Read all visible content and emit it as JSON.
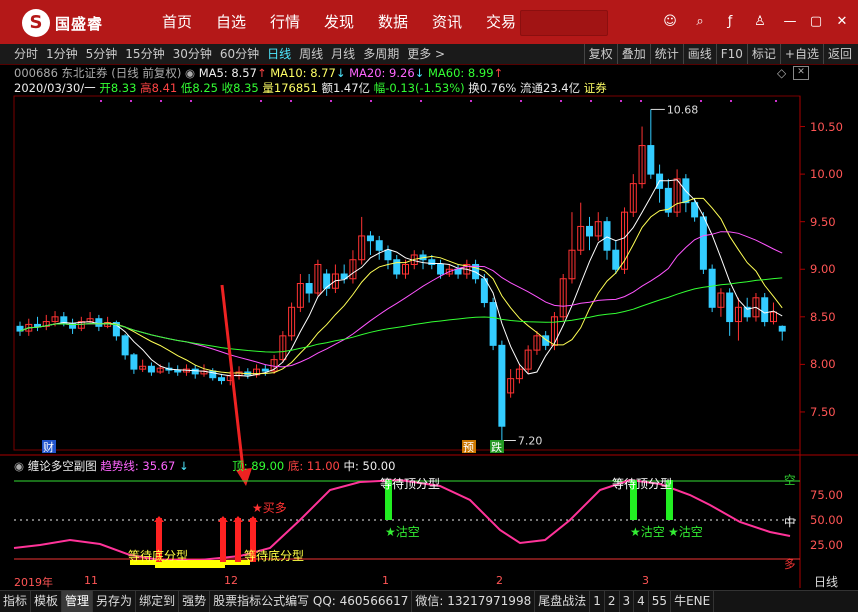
{
  "app": {
    "name": "国盛睿",
    "logo_mark": "S"
  },
  "top_nav": [
    "首页",
    "自选",
    "行情",
    "发现",
    "数据",
    "资讯",
    "交易"
  ],
  "window_controls": [
    "chat-icon",
    "search-icon",
    "fx-icon",
    "shirt-icon",
    "minimize-icon",
    "maximize-icon",
    "close-icon"
  ],
  "period_tabs": [
    "分时",
    "1分钟",
    "5分钟",
    "15分钟",
    "30分钟",
    "60分钟",
    "日线",
    "周线",
    "月线",
    "多周期",
    "更多 >"
  ],
  "active_period": "日线",
  "right_tools": [
    "复权",
    "叠加",
    "统计",
    "画线",
    "F10",
    "标记",
    "+自选",
    "返回"
  ],
  "stock": {
    "title": "000686 东北证券 (日线 前复权)",
    "ma5": "MA5: 8.57",
    "ma10": "MA10: 8.77",
    "ma20": "MA20: 9.26",
    "ma60": "MA60: 8.99",
    "line2_date": "2020/03/30/一",
    "open": "开8.33",
    "high": "高8.41",
    "low": "低8.25",
    "close": "收8.35",
    "volume": "量176851",
    "amount": "额1.47亿",
    "change": "幅-0.13(-1.53%)",
    "turnover": "换0.76%",
    "float": "流通23.4亿",
    "sector": "证券"
  },
  "annotations": {
    "high": "10.68",
    "low": "7.20",
    "cai": "财",
    "yu": "预",
    "die": "跌"
  },
  "chart_data": [
    {
      "type": "candlestick",
      "title": "000686 东北证券 (日线 前复权)",
      "yticks": [
        7.5,
        8.0,
        8.5,
        9.0,
        9.5,
        10.0,
        10.5
      ],
      "ylim": [
        7.1,
        10.8
      ],
      "series": [
        {
          "name": "MA5"
        },
        {
          "name": "MA10"
        },
        {
          "name": "MA20"
        },
        {
          "name": "MA60"
        }
      ],
      "candles": [
        [
          8.4,
          8.35,
          8.45,
          8.3
        ],
        [
          8.35,
          8.42,
          8.48,
          8.3
        ],
        [
          8.42,
          8.4,
          8.5,
          8.35
        ],
        [
          8.4,
          8.45,
          8.52,
          8.36
        ],
        [
          8.45,
          8.5,
          8.56,
          8.4
        ],
        [
          8.5,
          8.43,
          8.55,
          8.4
        ],
        [
          8.43,
          8.38,
          8.48,
          8.32
        ],
        [
          8.38,
          8.45,
          8.5,
          8.35
        ],
        [
          8.45,
          8.48,
          8.55,
          8.42
        ],
        [
          8.48,
          8.4,
          8.52,
          8.35
        ],
        [
          8.4,
          8.44,
          8.5,
          8.38
        ],
        [
          8.44,
          8.3,
          8.46,
          8.25
        ],
        [
          8.3,
          8.1,
          8.32,
          8.05
        ],
        [
          8.1,
          7.95,
          8.12,
          7.9
        ],
        [
          7.95,
          7.98,
          8.05,
          7.92
        ],
        [
          7.98,
          7.92,
          8.02,
          7.88
        ],
        [
          7.92,
          7.96,
          8.0,
          7.9
        ],
        [
          7.96,
          7.94,
          8.02,
          7.9
        ],
        [
          7.94,
          7.92,
          7.99,
          7.88
        ],
        [
          7.92,
          7.95,
          8.0,
          7.88
        ],
        [
          7.95,
          7.9,
          7.99,
          7.85
        ],
        [
          7.9,
          7.93,
          8.0,
          7.87
        ],
        [
          7.93,
          7.86,
          7.96,
          7.83
        ],
        [
          7.86,
          7.83,
          7.9,
          7.79
        ],
        [
          7.83,
          7.88,
          7.93,
          7.78
        ],
        [
          7.88,
          7.92,
          7.98,
          7.84
        ],
        [
          7.92,
          7.89,
          7.96,
          7.85
        ],
        [
          7.89,
          7.95,
          8.0,
          7.86
        ],
        [
          7.95,
          7.93,
          8.0,
          7.88
        ],
        [
          7.93,
          8.05,
          8.1,
          7.9
        ],
        [
          8.05,
          8.3,
          8.35,
          8.02
        ],
        [
          8.3,
          8.6,
          8.65,
          8.25
        ],
        [
          8.6,
          8.85,
          8.95,
          8.55
        ],
        [
          8.85,
          8.75,
          8.95,
          8.65
        ],
        [
          8.75,
          9.05,
          9.1,
          8.72
        ],
        [
          8.95,
          8.8,
          9.0,
          8.72
        ],
        [
          8.8,
          8.95,
          9.05,
          8.75
        ],
        [
          8.95,
          8.9,
          9.05,
          8.85
        ],
        [
          8.9,
          9.1,
          9.2,
          8.85
        ],
        [
          9.1,
          9.35,
          9.55,
          9.05
        ],
        [
          9.35,
          9.3,
          9.4,
          9.15
        ],
        [
          9.3,
          9.2,
          9.35,
          9.1
        ],
        [
          9.2,
          9.1,
          9.25,
          9.0
        ],
        [
          9.1,
          8.95,
          9.15,
          8.9
        ],
        [
          8.95,
          9.05,
          9.1,
          8.9
        ],
        [
          9.05,
          9.15,
          9.2,
          9.0
        ],
        [
          9.15,
          9.1,
          9.2,
          9.0
        ],
        [
          9.1,
          9.05,
          9.15,
          9.0
        ],
        [
          9.05,
          8.95,
          9.1,
          8.9
        ],
        [
          8.95,
          9.0,
          9.05,
          8.92
        ],
        [
          9.0,
          8.95,
          9.05,
          8.9
        ],
        [
          8.95,
          9.05,
          9.1,
          8.9
        ],
        [
          9.05,
          8.9,
          9.1,
          8.85
        ],
        [
          8.9,
          8.65,
          8.95,
          8.6
        ],
        [
          8.65,
          8.2,
          8.7,
          8.15
        ],
        [
          8.2,
          7.35,
          8.25,
          7.2
        ],
        [
          7.7,
          7.85,
          7.95,
          7.65
        ],
        [
          7.85,
          7.95,
          8.0,
          7.8
        ],
        [
          7.95,
          8.15,
          8.2,
          7.9
        ],
        [
          8.15,
          8.3,
          8.35,
          8.1
        ],
        [
          8.3,
          8.2,
          8.35,
          8.15
        ],
        [
          8.2,
          8.5,
          8.55,
          8.15
        ],
        [
          8.5,
          8.9,
          8.95,
          8.45
        ],
        [
          8.9,
          9.2,
          9.6,
          8.85
        ],
        [
          9.2,
          9.45,
          9.7,
          9.15
        ],
        [
          9.45,
          9.35,
          9.55,
          9.2
        ],
        [
          9.35,
          9.5,
          9.6,
          9.3
        ],
        [
          9.5,
          9.2,
          9.55,
          9.1
        ],
        [
          9.2,
          9.0,
          9.3,
          8.95
        ],
        [
          9.0,
          9.6,
          9.65,
          8.95
        ],
        [
          9.6,
          9.9,
          10.0,
          9.55
        ],
        [
          9.9,
          10.3,
          10.5,
          9.85
        ],
        [
          10.3,
          10.0,
          10.68,
          9.95
        ],
        [
          10.0,
          9.85,
          10.1,
          9.7
        ],
        [
          9.85,
          9.6,
          9.95,
          9.55
        ],
        [
          9.6,
          9.95,
          10.05,
          9.55
        ],
        [
          9.95,
          9.7,
          10.0,
          9.6
        ],
        [
          9.7,
          9.55,
          9.75,
          9.5
        ],
        [
          9.55,
          9.0,
          9.6,
          8.95
        ],
        [
          9.0,
          8.6,
          9.05,
          8.55
        ],
        [
          8.6,
          8.75,
          8.8,
          8.5
        ],
        [
          8.75,
          8.45,
          8.8,
          8.3
        ],
        [
          8.45,
          8.6,
          8.7,
          8.25
        ],
        [
          8.6,
          8.5,
          8.7,
          8.45
        ],
        [
          8.5,
          8.7,
          8.75,
          8.45
        ],
        [
          8.7,
          8.45,
          8.75,
          8.4
        ],
        [
          8.45,
          8.55,
          8.65,
          8.42
        ],
        [
          8.4,
          8.35,
          8.41,
          8.25
        ]
      ]
    },
    {
      "type": "line",
      "title": "缠论多空副图",
      "series": [
        {
          "name": "趋势线",
          "last": "35.67"
        }
      ],
      "levels": [
        "顶: 89.00",
        "底: 11.00",
        "中: 50.00"
      ],
      "yticks": [
        25.0,
        50.0,
        75.0
      ],
      "ylim": [
        0,
        100
      ],
      "labels": [
        "等待底分型",
        "等待底分型",
        "买多",
        "等待顶分型",
        "等待顶分型",
        "沽空",
        "沽空",
        "沽空"
      ],
      "right_marks": {
        "top": "空",
        "mid": "中",
        "bottom": "多"
      }
    }
  ],
  "xaxis": {
    "year": "2019年",
    "months": [
      "11",
      "12",
      "1",
      "2",
      "3"
    ],
    "period": "日线"
  },
  "sub_header": {
    "name": "缠论多空副图",
    "trend_label": "趋势线: 35.67",
    "top": "顶: 89.00",
    "bottom": "底: 11.00",
    "mid": "中: 50.00"
  },
  "bottom_tabs": [
    "指标",
    "模板",
    "管理",
    "另存为",
    "绑定到",
    "强势",
    "股票指标公式编写 QQ: 460566617",
    "微信: 13217971998",
    "尾盘战法",
    "1",
    "2",
    "3",
    "4",
    "55",
    "牛ENE"
  ],
  "active_bottom": "管理"
}
